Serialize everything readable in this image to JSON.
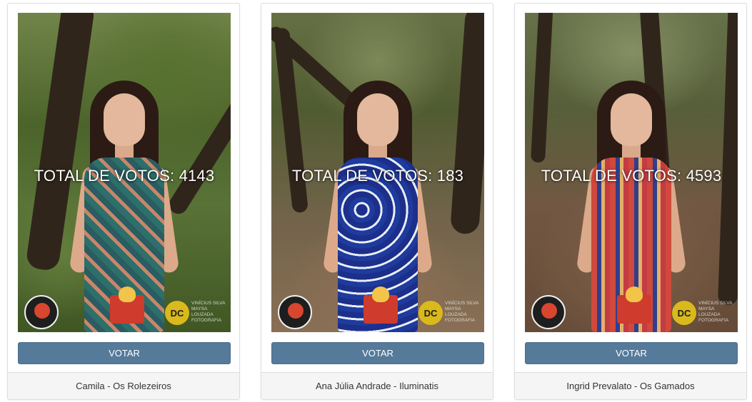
{
  "vote_button_label": "VOTAR",
  "accent_color": "#557a9a",
  "contestants": [
    {
      "name": "Camila - Os Rolezeiros",
      "vote_text": "TOTAL DE VOTOS: 4143",
      "votes": 4143
    },
    {
      "name": "Ana Júlia Andrade - Iluminatis",
      "vote_text": "TOTAL DE VOTOS: 183",
      "votes": 183
    },
    {
      "name": "Ingrid Prevalato - Os Gamados",
      "vote_text": "TOTAL DE VOTOS: 4593",
      "votes": 4593
    }
  ],
  "watermark": {
    "credit_line1": "VINÍCIUS SILVA",
    "credit_line2": "MAYSA LOUZADA",
    "credit_line3": "FOTOGRAFIA"
  }
}
